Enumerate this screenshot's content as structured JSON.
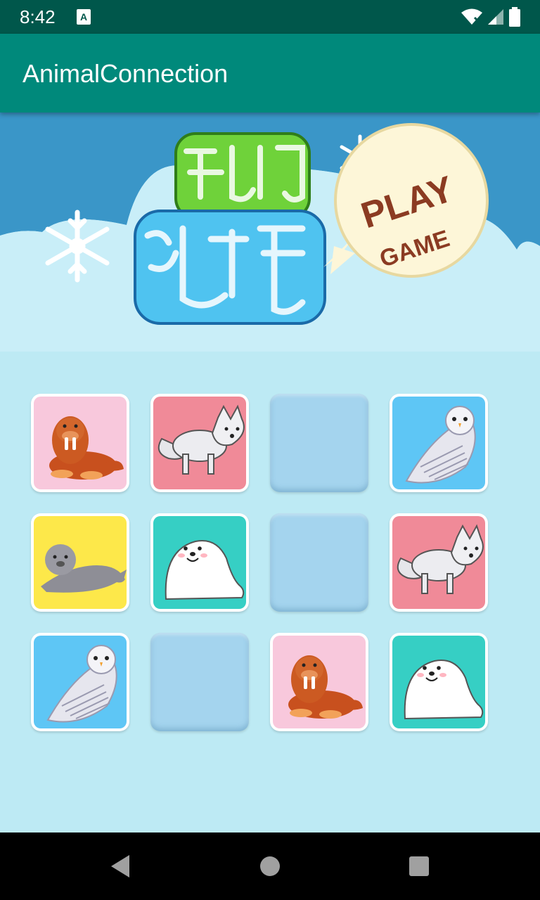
{
  "status_bar": {
    "time": "8:42",
    "icons": [
      "notification-a-icon",
      "wifi-icon",
      "signal-icon",
      "battery-icon"
    ]
  },
  "app_bar": {
    "title": "AnimalConnection"
  },
  "banner": {
    "speech_bubble_line1": "PLAY",
    "speech_bubble_line2": "GAME",
    "title_art": "动物连连看"
  },
  "board": {
    "rows": [
      [
        {
          "state": "face",
          "animal": "walrus",
          "bg": "#f8c8dc"
        },
        {
          "state": "face",
          "animal": "arctic-fox",
          "bg": "#f08a98"
        },
        {
          "state": "back"
        },
        {
          "state": "face",
          "animal": "snowy-owl",
          "bg": "#5ec6f5"
        }
      ],
      [
        {
          "state": "face",
          "animal": "grey-seal",
          "bg": "#fde84a"
        },
        {
          "state": "face",
          "animal": "harp-seal",
          "bg": "#36cfc4"
        },
        {
          "state": "back"
        },
        {
          "state": "face",
          "animal": "arctic-fox",
          "bg": "#f08a98"
        }
      ],
      [
        {
          "state": "face",
          "animal": "snowy-owl",
          "bg": "#5ec6f5"
        },
        {
          "state": "back"
        },
        {
          "state": "face",
          "animal": "walrus",
          "bg": "#f8c8dc"
        },
        {
          "state": "face",
          "animal": "harp-seal",
          "bg": "#36cfc4"
        }
      ]
    ]
  },
  "nav_bar": {
    "buttons": [
      "back-icon",
      "home-icon",
      "recents-icon"
    ]
  },
  "colors": {
    "status_bar": "#00574b",
    "app_bar": "#00897b",
    "background": "#bdeaf4",
    "sky": "#3a96c8",
    "tile_back": "#a4d4ee"
  }
}
